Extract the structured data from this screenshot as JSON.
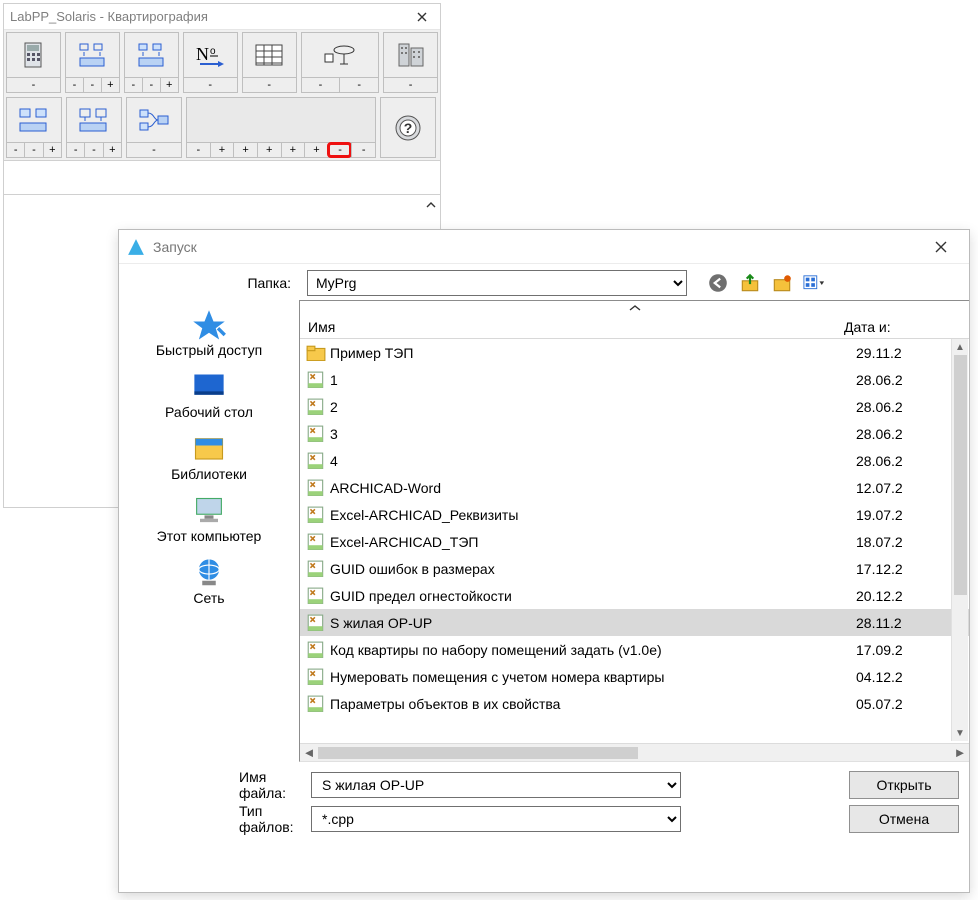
{
  "labpp": {
    "title": "LabPP_Solaris - Квартирография",
    "row1": [
      {
        "name": "calc-icon",
        "sub": [
          "-"
        ]
      },
      {
        "name": "align-grid-icon",
        "sub": [
          "-",
          "-",
          "+"
        ]
      },
      {
        "name": "align-grid2-icon",
        "sub": [
          "-",
          "-",
          "+"
        ]
      },
      {
        "name": "number-icon",
        "sub": [
          "-"
        ]
      },
      {
        "name": "table-icon",
        "sub": [
          "-"
        ]
      },
      {
        "name": "oval-checkbox-icon",
        "sub": [
          "-",
          "-"
        ]
      },
      {
        "name": "building-icon",
        "sub": [
          "-"
        ]
      }
    ],
    "row2": [
      {
        "name": "zones-a-icon",
        "sub": [
          "-",
          "-",
          "+"
        ]
      },
      {
        "name": "zones-b-icon",
        "sub": [
          "-",
          "-",
          "+"
        ]
      },
      {
        "name": "zones-link-icon",
        "sub": [
          "-"
        ]
      },
      {
        "name": "spacer",
        "sub": [
          "-",
          "+",
          "+",
          "+",
          "+",
          "+",
          "-",
          "-"
        ],
        "wide": true,
        "hl": 6
      },
      {
        "name": "help-icon",
        "sub": []
      }
    ]
  },
  "dialog": {
    "title": "Запуск",
    "folder_label": "Папка:",
    "folder_value": "MyPrg",
    "places": [
      {
        "icon": "star-icon",
        "label": "Быстрый доступ"
      },
      {
        "icon": "desktop-icon",
        "label": "Рабочий стол"
      },
      {
        "icon": "libraries-icon",
        "label": "Библиотеки"
      },
      {
        "icon": "computer-icon",
        "label": "Этот компьютер"
      },
      {
        "icon": "network-icon",
        "label": "Сеть"
      }
    ],
    "columns": {
      "name": "Имя",
      "date": "Дата и:"
    },
    "files": [
      {
        "icon": "folder",
        "name": "Пример ТЭП",
        "date": "29.11.2"
      },
      {
        "icon": "file",
        "name": "1",
        "date": "28.06.2"
      },
      {
        "icon": "file",
        "name": "2",
        "date": "28.06.2"
      },
      {
        "icon": "file",
        "name": "3",
        "date": "28.06.2"
      },
      {
        "icon": "file",
        "name": "4",
        "date": "28.06.2"
      },
      {
        "icon": "file",
        "name": "ARCHICAD-Word",
        "date": "12.07.2"
      },
      {
        "icon": "file",
        "name": "Excel-ARCHICAD_Реквизиты",
        "date": "19.07.2"
      },
      {
        "icon": "file",
        "name": "Excel-ARCHICAD_ТЭП",
        "date": "18.07.2"
      },
      {
        "icon": "file",
        "name": "GUID ошибок в размерах",
        "date": "17.12.2"
      },
      {
        "icon": "file",
        "name": "GUID предел огнестойкости",
        "date": "20.12.2"
      },
      {
        "icon": "file",
        "name": "S жилая OP-UP",
        "date": "28.11.2",
        "selected": true
      },
      {
        "icon": "file",
        "name": "Код квартиры по набору помещений задать (v1.0e)",
        "date": "17.09.2"
      },
      {
        "icon": "file",
        "name": "Нумеровать помещения с учетом номера квартиры",
        "date": "04.12.2"
      },
      {
        "icon": "file",
        "name": "Параметры объектов в их свойства",
        "date": "05.07.2"
      }
    ],
    "filename_label": "Имя файла:",
    "filename_value": "S жилая OP-UP",
    "filetype_label": "Тип файлов:",
    "filetype_value": "*.cpp",
    "open_label": "Открыть",
    "cancel_label": "Отмена"
  }
}
